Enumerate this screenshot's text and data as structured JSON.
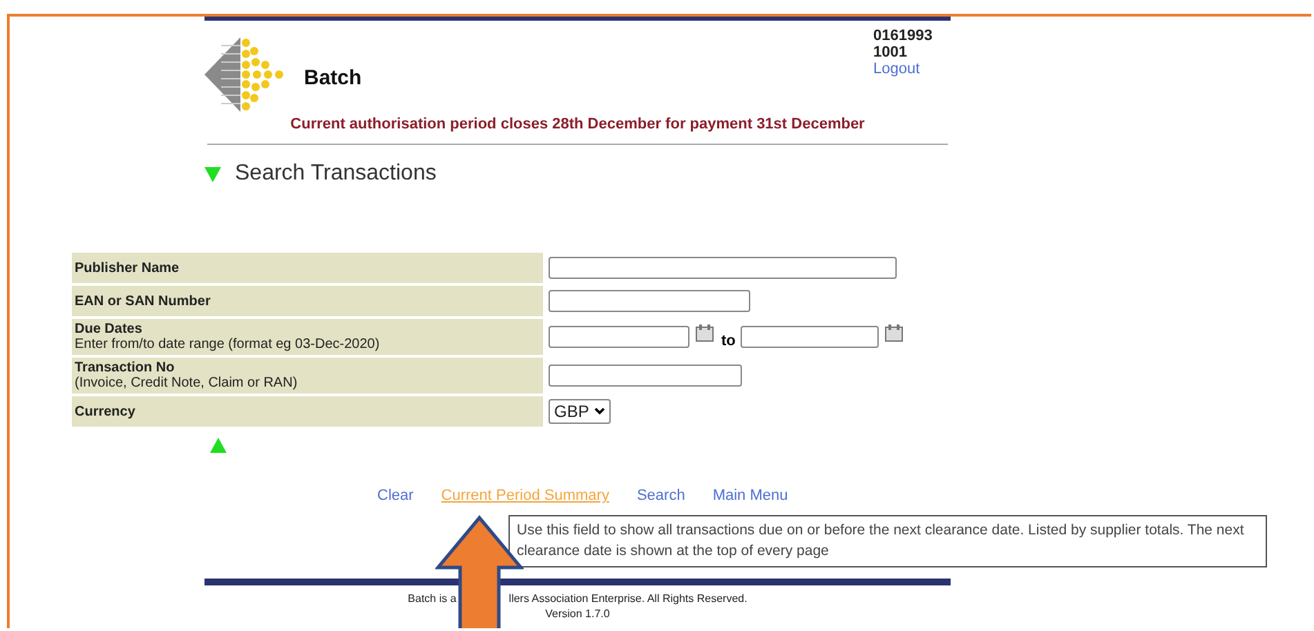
{
  "header": {
    "app_name": "Batch",
    "account_code": "0161993",
    "user_id": "1001",
    "logout": "Logout"
  },
  "notice": "Current authorisation period closes 28th December for payment 31st December",
  "section": {
    "title": "Search Transactions",
    "expanded": true
  },
  "form": {
    "rows": [
      {
        "label": "Publisher Name",
        "kind": "wide"
      },
      {
        "label": "EAN or SAN Number",
        "kind": "text"
      },
      {
        "label": "Due Dates",
        "hint": "Enter from/to date range (format eg 03-Dec-2020)",
        "kind": "daterange",
        "joiner": "to"
      },
      {
        "label": "Transaction No",
        "hint": "(Invoice, Credit Note, Claim or RAN)",
        "kind": "text"
      },
      {
        "label": "Currency",
        "kind": "select",
        "value": "GBP"
      }
    ]
  },
  "links": [
    {
      "label": "Clear",
      "hovered": false
    },
    {
      "label": "Current Period Summary",
      "hovered": true
    },
    {
      "label": "Search",
      "hovered": false
    },
    {
      "label": "Main Menu",
      "hovered": false
    }
  ],
  "tooltip": "Use this field to show all transactions due on or before the next clearance date. Listed by supplier totals. The next clearance date is shown at the top of every page",
  "footer": {
    "text_before": "Batch is a",
    "text_after": "llers Association Enterprise. All Rights Reserved.",
    "version": "Version 1.7.0"
  }
}
